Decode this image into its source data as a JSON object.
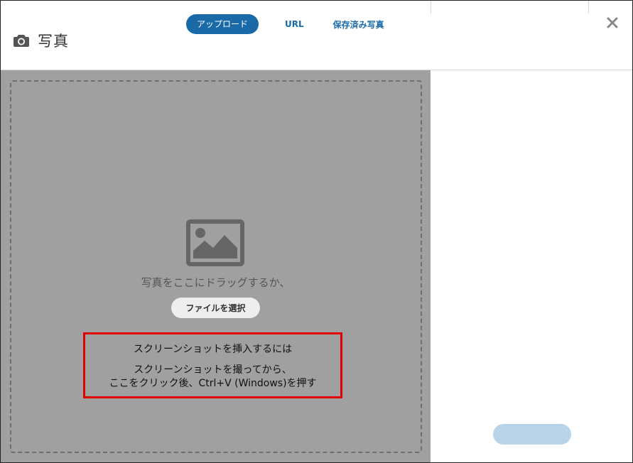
{
  "dialog": {
    "title": "写真",
    "title_icon": "camera-icon",
    "close_icon": "close-icon"
  },
  "tabs": [
    {
      "label": "アップロード",
      "active": true
    },
    {
      "label": "URL",
      "active": false
    },
    {
      "label": "保存済み写真",
      "active": false
    }
  ],
  "upload": {
    "placeholder_icon": "image-icon",
    "drag_text": "写真をここにドラッグするか、",
    "select_file_label": "ファイルを選択"
  },
  "help": {
    "title": "スクリーンショットを挿入するには",
    "line1": "スクリーンショットを撮ってから、",
    "line2": "ここをクリック後、Ctrl+V (Windows)を押す"
  },
  "colors": {
    "accent": "#1a6aa8",
    "drop_background": "#a0a0a0",
    "highlight_border": "#e00000",
    "disabled_button": "#b9d3e8"
  }
}
